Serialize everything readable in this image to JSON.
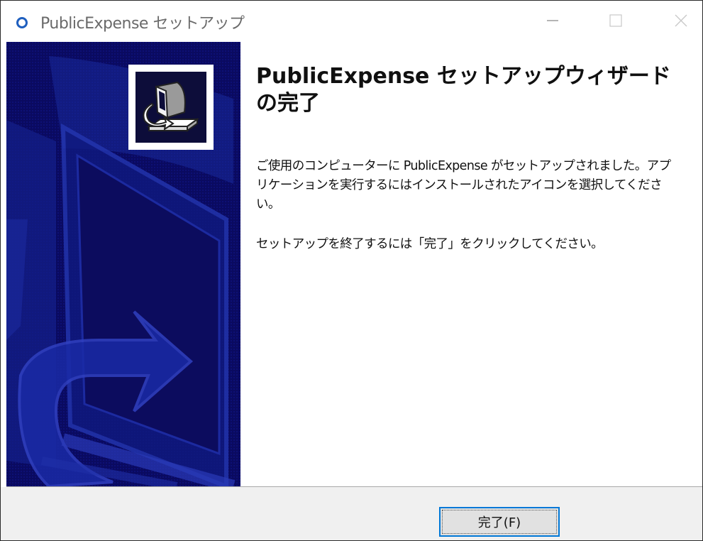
{
  "window": {
    "title": "PublicExpense セットアップ",
    "app_icon": "circle-o-icon",
    "controls": [
      "minimize-icon",
      "maximize-icon",
      "close-icon"
    ]
  },
  "banner": {
    "logo_icon": "installer-computer-icon",
    "background_color": "#0a0a60"
  },
  "main": {
    "heading": "PublicExpense セットアップウィザードの完了",
    "paragraph1": "ご使用のコンピューターに PublicExpense がセットアップされました。アプリケーションを実行するにはインストールされたアイコンを選択してください。",
    "paragraph2": "セットアップを終了するには「完了」をクリックしてください。"
  },
  "footer": {
    "finish_label": "完了(F)",
    "accent_color": "#0078d7"
  }
}
